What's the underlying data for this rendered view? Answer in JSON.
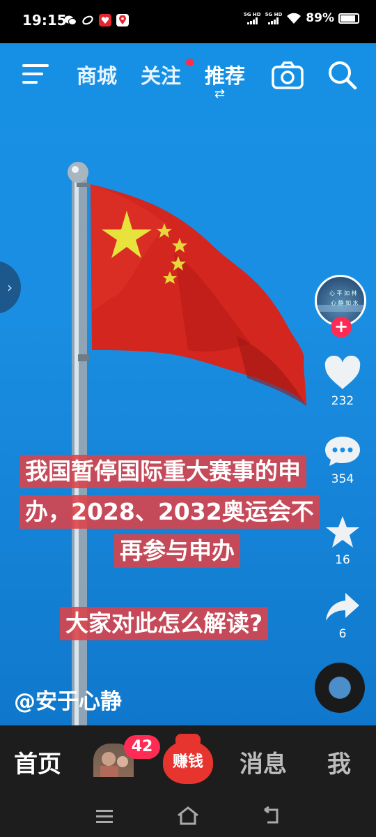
{
  "status_bar": {
    "time": "19:15",
    "network_1": "5G HD",
    "network_2": "5G HD",
    "battery": "89%",
    "icons": [
      "wechat-icon",
      "link-icon",
      "red-app-icon",
      "map-app-icon",
      "signal-icon",
      "wifi-icon",
      "battery-icon"
    ]
  },
  "top_nav": {
    "tabs": [
      {
        "label": "商城"
      },
      {
        "label": "关注"
      },
      {
        "label": "推荐"
      }
    ],
    "active_tab": "推荐",
    "icons": [
      "menu-icon",
      "camera-icon",
      "search-icon"
    ]
  },
  "video": {
    "caption_lines": [
      "我国暂停国际重大赛事的申",
      "办，2028、2032奥运会不",
      "再参与申办"
    ],
    "question": "大家对此怎么解读?",
    "author": "@安于心静"
  },
  "right_rail": {
    "likes": "232",
    "comments": "354",
    "favorites": "16",
    "shares": "6"
  },
  "bottom_nav": {
    "home": "首页",
    "friends_badge": "42",
    "earn": "赚钱",
    "messages": "消息",
    "me": "我"
  },
  "colors": {
    "accent": "#fe2c55",
    "caption_bg": "#de4248",
    "sky": "#1690e4",
    "nav_bg": "#1d1d1d"
  }
}
